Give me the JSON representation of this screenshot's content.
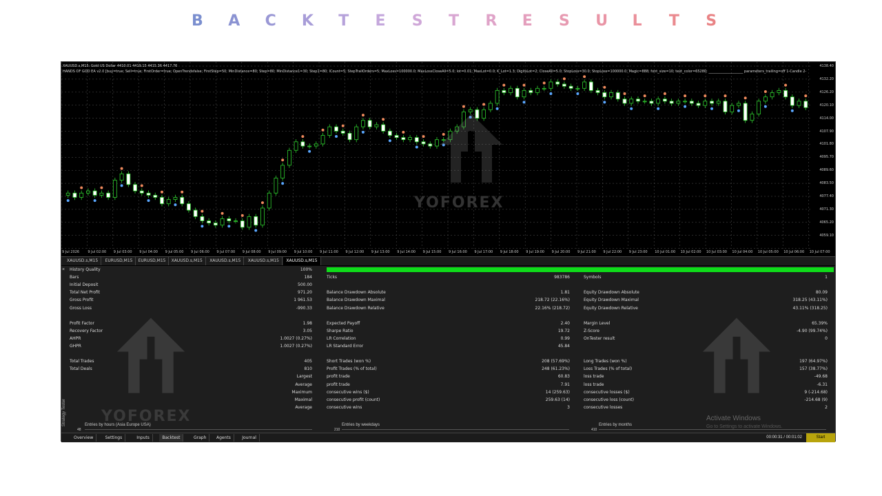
{
  "page_title": [
    "B",
    "A",
    "C",
    "K",
    "T",
    "E",
    "S",
    "T",
    "R",
    "E",
    "S",
    "U",
    "L",
    "T",
    "S"
  ],
  "title_colors": [
    "#7b8fcf",
    "#8b93d2",
    "#9a98d5",
    "#a89dd8",
    "#b6a2da",
    "#c4a7dc",
    "#cfa7d8",
    "#d8a6d2",
    "#dfa3c8",
    "#e49fbd",
    "#e79ab1",
    "#e995a6",
    "#ea8f9a",
    "#ea8a8f",
    "#e98385"
  ],
  "chart": {
    "header_line1": "XAUUSD.s,M15:  Gold US Dollar  4410.01 4419.15 4415.36 4417.76",
    "header_line2": "HANDS OF GOD EA v2.0 [buy=true; Sell=true; FirstOrder=true; OpenTrendsfalse; FirstStep=50; MinDistance=80; Step=80; MinDistance1=30; Step1=80; ICount=5; StepTrailOrders=5; MaxLoss=100000.0; MaxLossCloseAll=5.0; lot=0.01; MaxLot=0.0; K_Lot=1.3; DigitsLot=2; CloseAll=5.0; StopLoss=30.0; StopLoss=100000.0; Magic=888; font_size=10; text_color=65280; ____________________ parameters_trailing=off  1-Candle  2-",
    "price_ticks": [
      "4138.40",
      "4132.20",
      "4126.20",
      "4120.10",
      "4114.00",
      "4107.90",
      "4101.80",
      "4095.70",
      "4089.60",
      "4083.50",
      "4077.40",
      "4071.30",
      "4065.20",
      "4059.10"
    ],
    "time_ticks": [
      "9 Jul 2026",
      "9 Jul 02:00",
      "9 Jul 03:00",
      "9 Jul 04:00",
      "9 Jul 05:00",
      "9 Jul 06:00",
      "9 Jul 07:00",
      "9 Jul 08:00",
      "9 Jul 09:00",
      "9 Jul 10:00",
      "9 Jul 11:00",
      "9 Jul 12:00",
      "9 Jul 13:00",
      "9 Jul 14:00",
      "9 Jul 15:00",
      "9 Jul 16:00",
      "9 Jul 17:00",
      "9 Jul 18:00",
      "9 Jul 19:00",
      "9 Jul 20:00",
      "9 Jul 21:00",
      "9 Jul 22:00",
      "9 Jul 23:00",
      "10 Jul 01:00",
      "10 Jul 02:00",
      "10 Jul 03:00",
      "10 Jul 04:00",
      "10 Jul 05:00",
      "10 Jul 06:00",
      "10 Jul 07:00"
    ],
    "watermark": "YOFOREX",
    "closes": [
      4078,
      4079,
      4077,
      4079,
      4080,
      4078,
      4079,
      4077,
      4085,
      4088,
      4083,
      4080,
      4079,
      4078,
      4077,
      4074,
      4076,
      4077,
      4074,
      4071,
      4068,
      4066,
      4065,
      4064,
      4067,
      4066,
      4066,
      4063,
      4068,
      4064,
      4072,
      4079,
      4086,
      4092,
      4099,
      4103,
      4101,
      4101,
      4102,
      4106,
      4110,
      4108,
      4107,
      4104,
      4110,
      4113,
      4110,
      4111,
      4108,
      4106,
      4105,
      4104,
      4105,
      4103,
      4102,
      4101,
      4104,
      4104,
      4108,
      4110,
      4117,
      4118,
      4114,
      4118,
      4121,
      4127,
      4126,
      4128,
      4124,
      4127,
      4126,
      4128,
      4128,
      4131,
      4130,
      4129,
      4128,
      4128,
      4131,
      4127,
      4126,
      4124,
      4126,
      4123,
      4121,
      4123,
      4122,
      4122,
      4121,
      4123,
      4122,
      4121,
      4122,
      4122,
      4121,
      4120,
      4122,
      4121,
      4122,
      4117,
      4120,
      4121,
      4113,
      4116,
      4122,
      4124,
      4126,
      4127,
      4124,
      4120,
      4122,
      4119
    ]
  },
  "symbol_tabs": [
    "XAUUSD.s,M15",
    "EURUSD,M15",
    "EURUSD,M15",
    "XAUUSD.s,M15",
    "XAUUSD.s,M15",
    "XAUUSD.s,M15",
    "XAUUSD.s,M15"
  ],
  "results": {
    "col1": [
      [
        "History Quality",
        "100%"
      ],
      [
        "Bars",
        "184"
      ],
      [
        "Initial Deposit",
        "500.00"
      ],
      [
        "Total Net Profit",
        "971.20"
      ],
      [
        "Gross Profit",
        "1 961.53"
      ],
      [
        "Gross Loss",
        "-990.33"
      ],
      [
        "",
        ""
      ],
      [
        "Profit Factor",
        "1.98"
      ],
      [
        "Recovery Factor",
        "3.05"
      ],
      [
        "AHPR",
        "1.0027 (0.27%)"
      ],
      [
        "GHPR",
        "1.0027 (0.27%)"
      ],
      [
        "",
        ""
      ],
      [
        "Total Trades",
        "405"
      ],
      [
        "Total Deals",
        "810"
      ]
    ],
    "col1_right_labels": [
      "Largest",
      "Average",
      "Maximum",
      "Maximal",
      "Average"
    ],
    "col2": [
      [
        "",
        ""
      ],
      [
        "Ticks",
        "983786"
      ],
      [
        "",
        ""
      ],
      [
        "Balance Drawdown Absolute",
        "1.81"
      ],
      [
        "Balance Drawdown Maximal",
        "218.72 (22.16%)"
      ],
      [
        "Balance Drawdown Relative",
        "22.16% (218.72)"
      ],
      [
        "",
        ""
      ],
      [
        "Expected Payoff",
        "2.40"
      ],
      [
        "Sharpe Ratio",
        "19.72"
      ],
      [
        "LR Correlation",
        "0.99"
      ],
      [
        "LR Standard Error",
        "45.84"
      ],
      [
        "",
        ""
      ],
      [
        "Short Trades (won %)",
        "208 (57.69%)"
      ],
      [
        "Profit Trades (% of total)",
        "248 (61.23%)"
      ],
      [
        "profit trade",
        "60.83"
      ],
      [
        "profit trade",
        "7.91"
      ],
      [
        "consecutive wins ($)",
        "14 (259.63)"
      ],
      [
        "consecutive profit (count)",
        "259.63 (14)"
      ],
      [
        "consecutive wins",
        "3"
      ]
    ],
    "col3": [
      [
        "",
        ""
      ],
      [
        "Symbols",
        "1"
      ],
      [
        "",
        ""
      ],
      [
        "Equity Drawdown Absolute",
        "80.09"
      ],
      [
        "Equity Drawdown Maximal",
        "318.25 (43.11%)"
      ],
      [
        "Equity Drawdown Relative",
        "43.11% (318.25)"
      ],
      [
        "",
        ""
      ],
      [
        "Margin Level",
        "65.39%"
      ],
      [
        "Z-Score",
        "-4.90 (99.74%)"
      ],
      [
        "OnTester result",
        "0"
      ],
      [
        "",
        ""
      ],
      [
        "",
        ""
      ],
      [
        "Long Trades (won %)",
        "197 (64.97%)"
      ],
      [
        "Loss Trades (% of total)",
        "157 (38.77%)"
      ],
      [
        "loss trade",
        "-49.68"
      ],
      [
        "loss trade",
        "-6.31"
      ],
      [
        "consecutive losses ($)",
        "9 (-214.68)"
      ],
      [
        "consecutive loss (count)",
        "-214.68 (9)"
      ],
      [
        "consecutive losses",
        "2"
      ]
    ],
    "mini_charts": [
      {
        "title": "Entries by hours (Asia Europe USA)",
        "ymax": "48"
      },
      {
        "title": "Entries by weekdays",
        "ymax": "210"
      },
      {
        "title": "Entries by months",
        "ymax": "410"
      }
    ],
    "side_label": "Strategy Tester",
    "close_icon": "×",
    "watermark": "YOFOREX"
  },
  "bottom_tabs": [
    "Overview",
    "Settings",
    "Inputs",
    "Backtest",
    "Graph",
    "Agents",
    "Journal"
  ],
  "active_bottom_tab": "Backtest",
  "timer": "00:00:31 / 00:01:02",
  "start_label": "Start",
  "activate_title": "Activate Windows",
  "activate_sub": "Go to Settings to activate Windows."
}
